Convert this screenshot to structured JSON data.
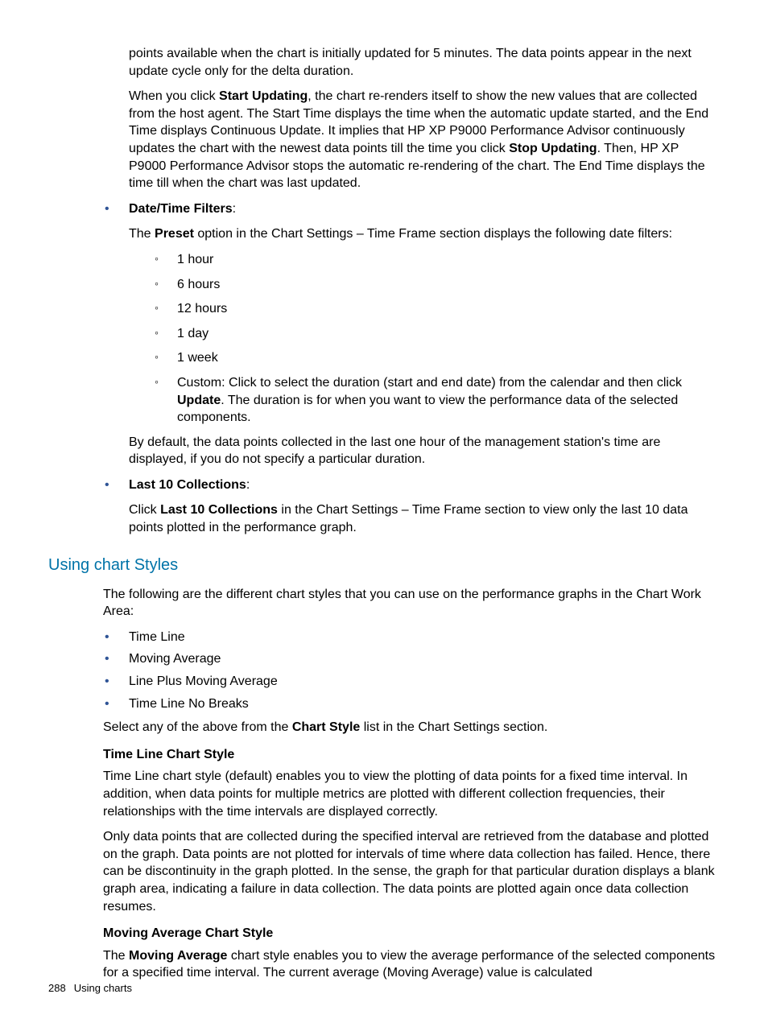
{
  "intro": {
    "p1": "points available when the chart is initially updated for 5 minutes. The data points appear in the next update cycle only for the delta duration.",
    "p2a": "When you click ",
    "p2b": "Start Updating",
    "p2c": ", the chart re-renders itself to show the new values that are collected from the host agent. The Start Time displays the time when the automatic update started, and the End Time displays Continuous Update. It implies that HP XP P9000 Performance Advisor continuously updates the chart with the newest data points till the time you click ",
    "p2d": "Stop Updating",
    "p2e": ". Then, HP XP P9000 Performance Advisor stops the automatic re-rendering of the chart. The End Time displays the time till when the chart was last updated."
  },
  "bullets": {
    "date": {
      "title": "Date/Time Filters",
      "colon_after_title": ":",
      "p1a": "The ",
      "p1b": "Preset",
      "p1c": " option in the Chart Settings – Time Frame section displays the following date filters:",
      "items": {
        "i0": "1 hour",
        "i1": "6 hours",
        "i2": "12 hours",
        "i3": "1 day",
        "i4": "1 week",
        "i5a": "Custom: Click to select the duration (start and end date) from the calendar and then click ",
        "i5b": "Update",
        "i5c": ". The duration is for when you want to view the performance data of the selected components."
      },
      "p2": "By default, the data points collected in the last one hour of the management station's time are displayed, if you do not specify a particular duration."
    },
    "last10": {
      "title": "Last 10 Collections",
      "colon_after_title": ":",
      "p1a": "Click ",
      "p1b": "Last 10 Collections",
      "p1c": " in the Chart Settings – Time Frame section to view only the last 10 data points plotted in the performance graph."
    }
  },
  "section_heading": "Using chart Styles",
  "styles_intro": "The following are the different chart styles that you can use on the performance graphs in the Chart Work Area:",
  "styles": {
    "s0": "Time Line",
    "s1": "Moving Average",
    "s2": "Line Plus Moving Average",
    "s3": "Time Line No Breaks"
  },
  "styles_select": {
    "a": "Select any of the above from the ",
    "b": "Chart Style",
    "c": " list in the Chart Settings section."
  },
  "timeline": {
    "heading": "Time Line Chart Style",
    "p1": "Time Line chart style (default) enables you to view the plotting of data points for a fixed time interval. In addition, when data points for multiple metrics are plotted with different collection frequencies, their relationships with the time intervals are displayed correctly.",
    "p2": "Only data points that are collected during the specified interval are retrieved from the database and plotted on the graph. Data points are not plotted for intervals of time where data collection has failed. Hence, there can be discontinuity in the graph plotted. In the sense, the graph for that particular duration displays a blank graph area, indicating a failure in data collection. The data points are plotted again once data collection resumes."
  },
  "moving_avg": {
    "heading": "Moving Average Chart Style",
    "p1a": "The ",
    "p1b": "Moving Average",
    "p1c": " chart style enables you to view the average performance of the selected components for a specified time interval. The current average (Moving Average) value is calculated"
  },
  "footer": {
    "page": "288",
    "label": "Using charts"
  }
}
